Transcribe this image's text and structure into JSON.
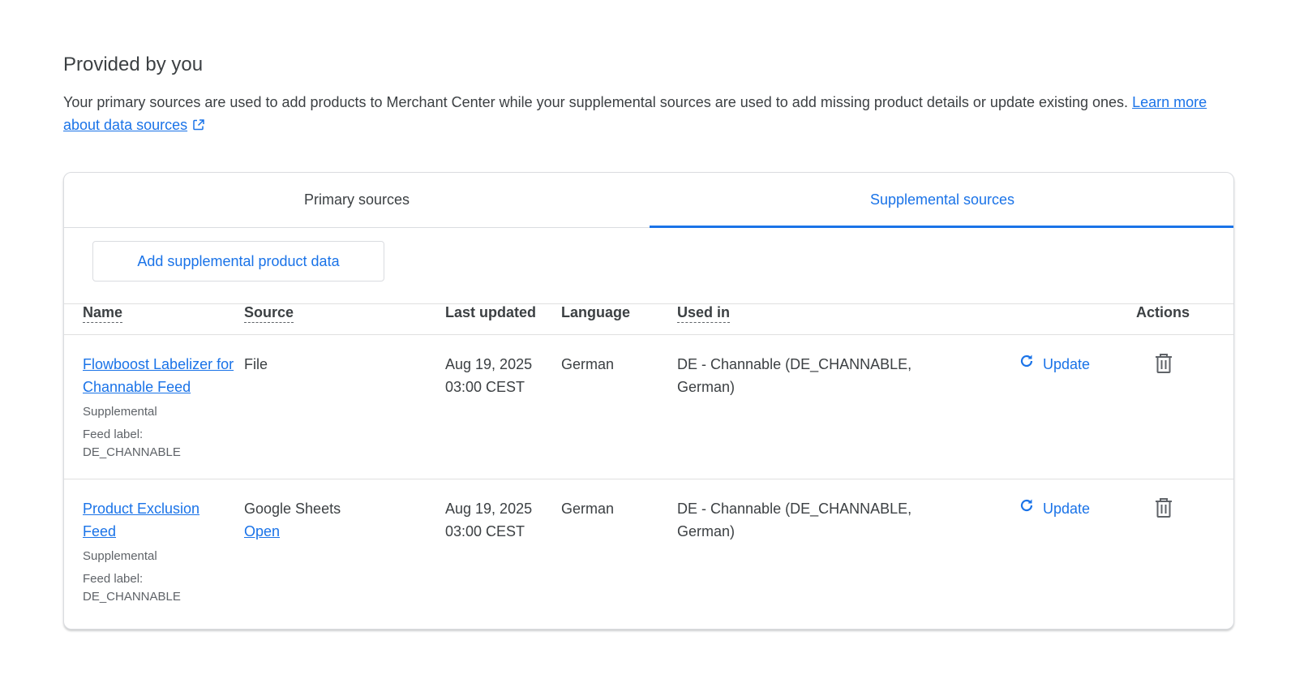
{
  "section": {
    "title": "Provided by you",
    "description": "Your primary sources are used to add products to Merchant Center while your supplemental sources are used to add missing product details or update existing ones.",
    "learn_more": "Learn more about data sources"
  },
  "tabs": [
    {
      "label": "Primary sources",
      "active": false
    },
    {
      "label": "Supplemental sources",
      "active": true
    }
  ],
  "toolbar": {
    "add_button": "Add supplemental product data"
  },
  "table": {
    "headers": {
      "name": "Name",
      "source": "Source",
      "last_updated": "Last updated",
      "language": "Language",
      "used_in": "Used in",
      "actions": "Actions"
    },
    "rows": [
      {
        "name": "Flowboost Labelizer for Channable Feed",
        "type": "Supplemental",
        "feed_label_title": "Feed label:",
        "feed_label": "DE_CHANNABLE",
        "source": "File",
        "source_link": "",
        "date": "Aug 19, 2025",
        "time": "03:00 CEST",
        "language": "German",
        "used_in": "DE - Channable (DE_CHANNABLE, German)",
        "update": "Update"
      },
      {
        "name": "Product Exclusion Feed",
        "type": "Supplemental",
        "feed_label_title": "Feed label:",
        "feed_label": "DE_CHANNABLE",
        "source": "Google Sheets",
        "source_link": "Open",
        "date": "Aug 19, 2025",
        "time": "03:00 CEST",
        "language": "German",
        "used_in": "DE - Channable (DE_CHANNABLE, German)",
        "update": "Update"
      }
    ]
  },
  "colors": {
    "accent": "#1a73e8",
    "text": "#3c4043",
    "secondary_text": "#5f6368",
    "divider": "#e0e0e0"
  },
  "icons": {
    "external_link": "open-in-new-icon",
    "update": "refresh-icon",
    "delete": "trash-icon"
  }
}
